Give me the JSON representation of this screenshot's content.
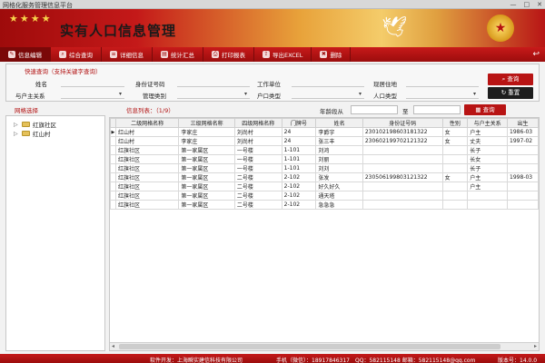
{
  "window": {
    "title": "网格化服务管理信息平台",
    "btn_min": "—",
    "btn_max": "□",
    "btn_close": "✕"
  },
  "banner": {
    "title": "实有人口信息管理",
    "stars": "★★★★"
  },
  "toolbar": {
    "items": [
      {
        "label": "信息编辑",
        "icon": "✎"
      },
      {
        "label": "综合查询",
        "icon": "⌕"
      },
      {
        "label": "详细信息",
        "icon": "≡"
      },
      {
        "label": "统计汇总",
        "icon": "▤"
      },
      {
        "label": "打印报表",
        "icon": "⎙"
      },
      {
        "label": "导出EXCEL",
        "icon": "⇪"
      },
      {
        "label": "删除",
        "icon": "✖"
      }
    ],
    "back_icon": "↩"
  },
  "search": {
    "heading": "快速查询（支持关键字查询）",
    "labels": {
      "name": "姓名",
      "id_number": "身份证号码",
      "work_unit": "工作单位",
      "current_address": "现居住地",
      "relation": "与户主关系",
      "mgmt_type": "管理类别",
      "household_type": "户口类型",
      "population_type": "人口类型"
    },
    "query_btn": "查询",
    "reset_btn": "重置"
  },
  "tree": {
    "heading": "网格选择",
    "nodes": [
      {
        "label": "红旗社区"
      },
      {
        "label": "红山村"
      }
    ]
  },
  "list": {
    "heading": "信息列表：（1/9）",
    "age_label": "年龄段从",
    "age_to": "至",
    "query_btn": "查询",
    "columns": [
      "二级网格名称",
      "三级网格名称",
      "四级网格名称",
      "门牌号",
      "姓名",
      "身份证号码",
      "性别",
      "与户主关系",
      "出生"
    ],
    "rows": [
      [
        "红山村",
        "李家庄",
        "刘尚村",
        "24",
        "李爵宇",
        "230102198603181322",
        "女",
        "户主",
        "1986-03"
      ],
      [
        "红山村",
        "李家庄",
        "刘尚村",
        "24",
        "张三丰",
        "230602199702121322",
        "女",
        "丈夫",
        "1997-02"
      ],
      [
        "红旗社区",
        "第一家属区",
        "一号楼",
        "1-101",
        "刘鸿",
        "",
        "",
        "长子",
        ""
      ],
      [
        "红旗社区",
        "第一家属区",
        "一号楼",
        "1-101",
        "刘丽",
        "",
        "",
        "长女",
        ""
      ],
      [
        "红旗社区",
        "第一家属区",
        "一号楼",
        "1-101",
        "刘刘",
        "",
        "",
        "长子",
        ""
      ],
      [
        "红旗社区",
        "第一家属区",
        "二号楼",
        "2-102",
        "张发",
        "230506199803121322",
        "女",
        "户主",
        "1998-03"
      ],
      [
        "红旗社区",
        "第一家属区",
        "二号楼",
        "2-102",
        "好久好久",
        "",
        "",
        "户主",
        ""
      ],
      [
        "红旗社区",
        "第一家属区",
        "二号楼",
        "2-102",
        "通天塔",
        "",
        "",
        "",
        ""
      ],
      [
        "红旗社区",
        "第一家属区",
        "二号楼",
        "2-102",
        "急急急",
        "",
        "",
        "",
        ""
      ]
    ]
  },
  "status": {
    "dev": "软件开发：上海瞬实建信科技有限公司",
    "phone": "手机（微信）：18917846317",
    "qq": "QQ：582115148  邮箱：582115148@qq.com",
    "version": "版本号：14.0.0"
  },
  "colors": {
    "accent": "#b81414",
    "toolbar": "#c81a1a"
  }
}
